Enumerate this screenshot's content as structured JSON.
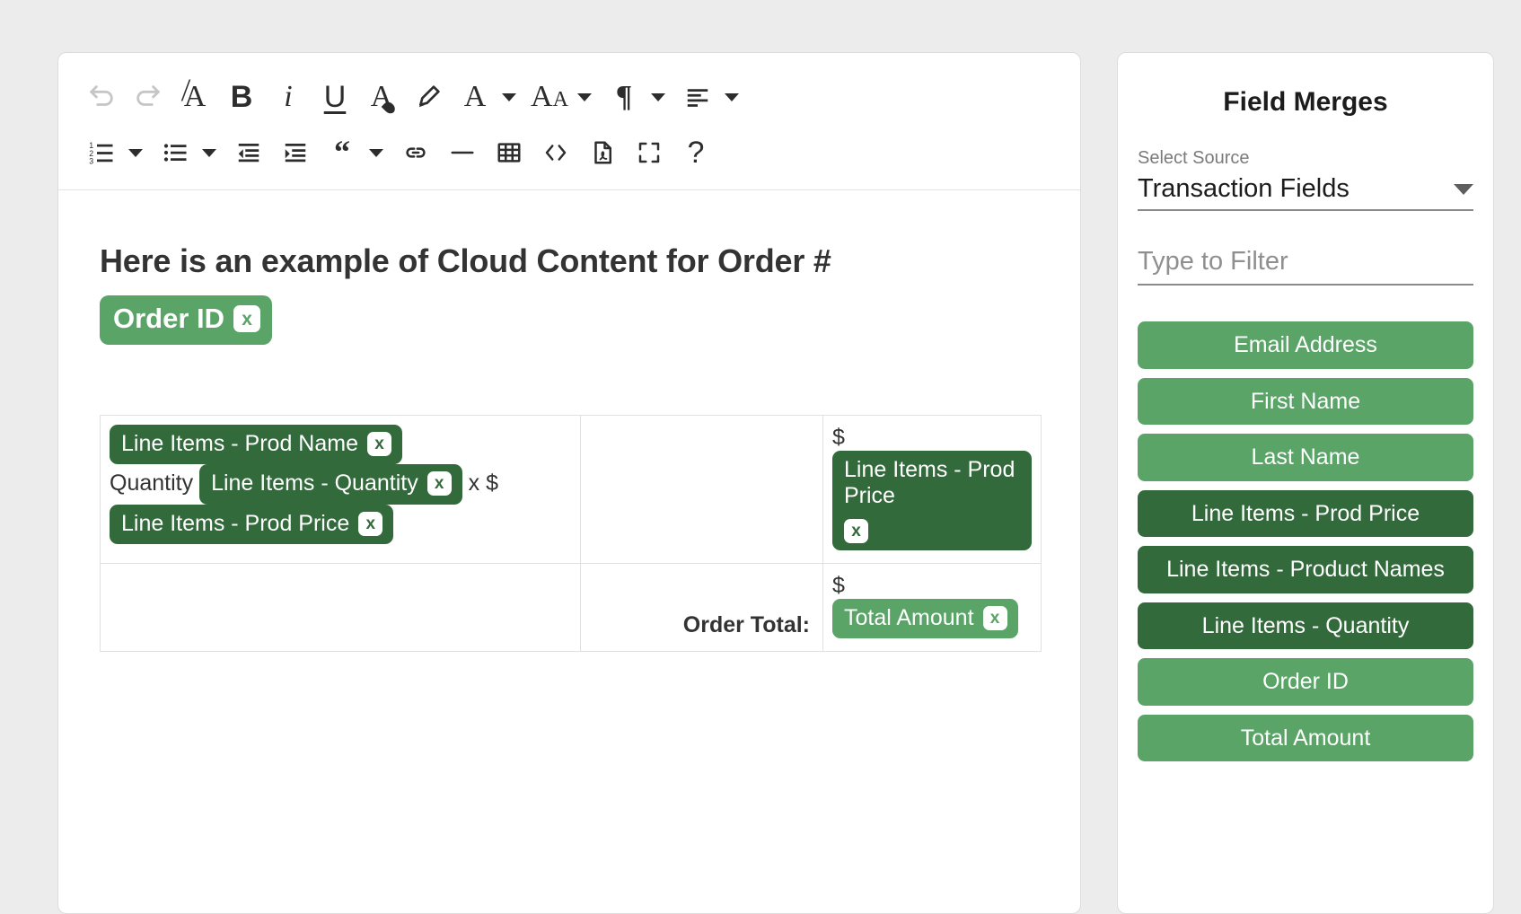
{
  "editor": {
    "toolbar": {
      "rows": [
        [
          {
            "name": "undo-icon",
            "label": "Undo",
            "icon": "undo",
            "disabled": true
          },
          {
            "name": "redo-icon",
            "label": "Redo",
            "icon": "redo",
            "disabled": true
          },
          {
            "name": "clear-formatting-icon",
            "label": "Clear Formatting",
            "icon": "clear-format"
          },
          {
            "name": "bold-icon",
            "label": "Bold",
            "icon": "bold"
          },
          {
            "name": "italic-icon",
            "label": "Italic",
            "icon": "italic"
          },
          {
            "name": "underline-icon",
            "label": "Underline",
            "icon": "underline"
          },
          {
            "name": "text-color-icon",
            "label": "Text Color",
            "icon": "text-color"
          },
          {
            "name": "highlight-icon",
            "label": "Highlight",
            "icon": "highlight"
          },
          {
            "name": "font-family-icon",
            "label": "Font Family",
            "icon": "font-family",
            "caret": true
          },
          {
            "name": "font-size-icon",
            "label": "Font Size",
            "icon": "font-size",
            "caret": true
          },
          {
            "name": "paragraph-format-icon",
            "label": "Paragraph Format",
            "icon": "paragraph",
            "caret": true
          },
          {
            "name": "align-icon",
            "label": "Align",
            "icon": "align",
            "caret": true
          }
        ],
        [
          {
            "name": "ordered-list-icon",
            "label": "Ordered List",
            "icon": "ordered-list",
            "caret": true
          },
          {
            "name": "unordered-list-icon",
            "label": "Unordered List",
            "icon": "unordered-list",
            "caret": true
          },
          {
            "name": "outdent-icon",
            "label": "Decrease Indent",
            "icon": "outdent"
          },
          {
            "name": "indent-icon",
            "label": "Increase Indent",
            "icon": "indent"
          },
          {
            "name": "quote-icon",
            "label": "Quote",
            "icon": "quote",
            "caret": true
          },
          {
            "name": "insert-link-icon",
            "label": "Insert Link",
            "icon": "link"
          },
          {
            "name": "horizontal-rule-icon",
            "label": "Horizontal Line",
            "icon": "hr"
          },
          {
            "name": "insert-table-icon",
            "label": "Insert Table",
            "icon": "table"
          },
          {
            "name": "code-view-icon",
            "label": "Code View",
            "icon": "code"
          },
          {
            "name": "export-pdf-icon",
            "label": "Export PDF",
            "icon": "pdf"
          },
          {
            "name": "fullscreen-icon",
            "label": "Fullscreen",
            "icon": "fullscreen"
          },
          {
            "name": "help-icon",
            "label": "Help",
            "icon": "help"
          }
        ]
      ]
    },
    "document": {
      "heading_text": "Here is an example of Cloud Content for Order #",
      "heading_token": "Order ID",
      "table": {
        "rows": [
          {
            "cells": [
              {
                "name": "product-cell",
                "parts": [
                  {
                    "type": "token",
                    "text": "Line Items - Prod Name",
                    "shade": "dark"
                  },
                  {
                    "type": "linebreak"
                  },
                  {
                    "type": "text",
                    "text": "Quantity "
                  },
                  {
                    "type": "token",
                    "text": "Line Items - Quantity",
                    "shade": "dark"
                  },
                  {
                    "type": "text",
                    "text": " x $"
                  },
                  {
                    "type": "linebreak"
                  },
                  {
                    "type": "token",
                    "text": "Line Items - Prod Price",
                    "shade": "dark"
                  }
                ]
              },
              {
                "name": "middle-cell",
                "parts": []
              },
              {
                "name": "price-cell",
                "parts": [
                  {
                    "type": "text",
                    "text": "$"
                  },
                  {
                    "type": "linebreak"
                  },
                  {
                    "type": "token",
                    "text": "Line Items - Prod Price",
                    "shade": "dark"
                  }
                ]
              }
            ]
          },
          {
            "cells": [
              {
                "name": "empty-cell",
                "parts": []
              },
              {
                "name": "order-total-label-cell",
                "label": "Order Total:"
              },
              {
                "name": "order-total-value-cell",
                "parts": [
                  {
                    "type": "text",
                    "text": "$"
                  },
                  {
                    "type": "linebreak"
                  },
                  {
                    "type": "token",
                    "text": "Total Amount",
                    "shade": "light"
                  }
                ]
              }
            ]
          }
        ]
      }
    }
  },
  "panel": {
    "title": "Field Merges",
    "select_source": {
      "label": "Select Source",
      "value": "Transaction Fields"
    },
    "filter": {
      "placeholder": "Type to Filter",
      "value": ""
    },
    "merge_fields": [
      {
        "label": "Email Address",
        "shade": "light"
      },
      {
        "label": "First Name",
        "shade": "light"
      },
      {
        "label": "Last Name",
        "shade": "light"
      },
      {
        "label": "Line Items - Prod Price",
        "shade": "dark"
      },
      {
        "label": "Line Items - Product Names",
        "shade": "dark"
      },
      {
        "label": "Line Items - Quantity",
        "shade": "dark"
      },
      {
        "label": "Order ID",
        "shade": "light"
      },
      {
        "label": "Total Amount",
        "shade": "light"
      }
    ]
  },
  "colors": {
    "token_light": "#5aa468",
    "token_dark": "#336a3c",
    "page_background": "#ececec",
    "card_background": "#ffffff"
  }
}
